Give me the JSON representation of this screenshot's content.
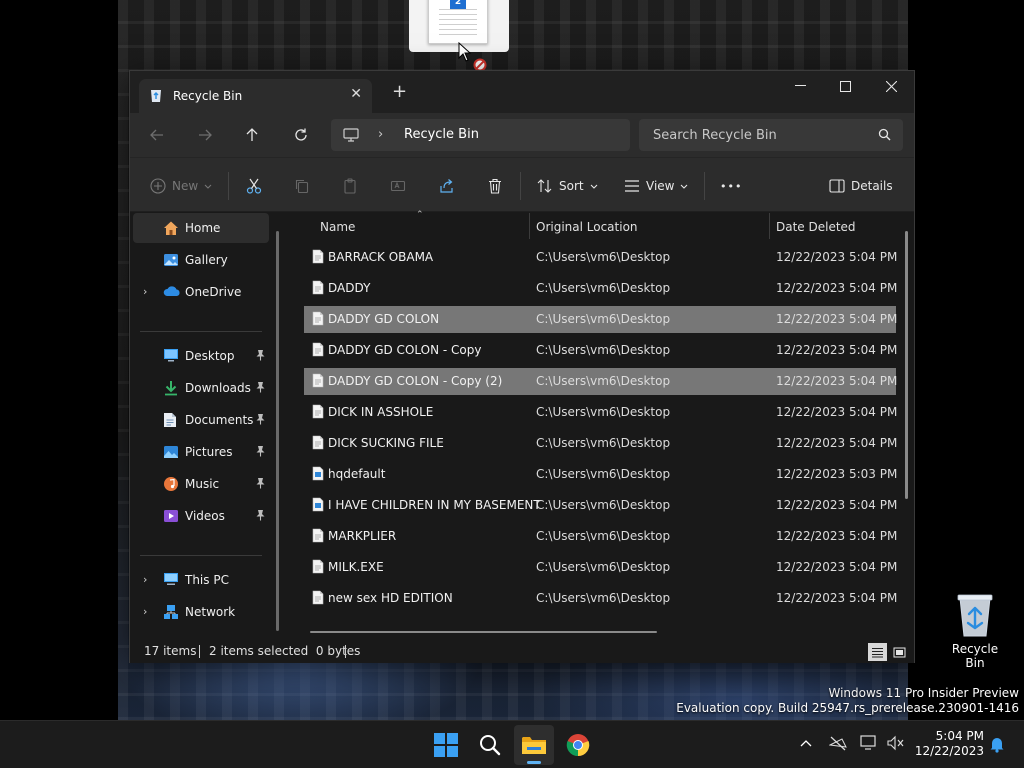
{
  "window": {
    "tab_title": "Recycle Bin",
    "tab_close": "✕",
    "new_tab": "+",
    "minimize": "—",
    "maximize": "☐",
    "close": "✕"
  },
  "nav": {
    "address_path": "Recycle Bin",
    "address_chevron": "›",
    "search_placeholder": "Search Recycle Bin"
  },
  "toolbar": {
    "new_label": "New",
    "sort_label": "Sort",
    "view_label": "View",
    "more_label": "•••",
    "details_label": "Details"
  },
  "sidebar": {
    "items": [
      {
        "label": "Home",
        "icon": "home-icon",
        "expandable": false,
        "pinned": false,
        "selected": true
      },
      {
        "label": "Gallery",
        "icon": "gallery-icon",
        "expandable": false,
        "pinned": false
      },
      {
        "label": "OneDrive",
        "icon": "onedrive-icon",
        "expandable": true,
        "pinned": false
      },
      {
        "label": "Desktop",
        "icon": "desktop-icon",
        "expandable": false,
        "pinned": true
      },
      {
        "label": "Downloads",
        "icon": "downloads-icon",
        "expandable": false,
        "pinned": true
      },
      {
        "label": "Documents",
        "icon": "documents-icon",
        "expandable": false,
        "pinned": true
      },
      {
        "label": "Pictures",
        "icon": "pictures-icon",
        "expandable": false,
        "pinned": true
      },
      {
        "label": "Music",
        "icon": "music-icon",
        "expandable": false,
        "pinned": true
      },
      {
        "label": "Videos",
        "icon": "videos-icon",
        "expandable": false,
        "pinned": true
      },
      {
        "label": "This PC",
        "icon": "this-pc-icon",
        "expandable": true,
        "pinned": false
      },
      {
        "label": "Network",
        "icon": "network-icon",
        "expandable": true,
        "pinned": false
      }
    ],
    "expand_glyph": "›"
  },
  "columns": {
    "name": "Name",
    "location": "Original Location",
    "date": "Date Deleted"
  },
  "files": [
    {
      "name": "BARRACK OBAMA",
      "location": "C:\\Users\\vm6\\Desktop",
      "date": "12/22/2023 5:04 PM",
      "selected": false
    },
    {
      "name": "DADDY",
      "location": "C:\\Users\\vm6\\Desktop",
      "date": "12/22/2023 5:04 PM",
      "selected": false
    },
    {
      "name": "DADDY GD COLON",
      "location": "C:\\Users\\vm6\\Desktop",
      "date": "12/22/2023 5:04 PM",
      "selected": true
    },
    {
      "name": "DADDY GD COLON - Copy",
      "location": "C:\\Users\\vm6\\Desktop",
      "date": "12/22/2023 5:04 PM",
      "selected": false
    },
    {
      "name": "DADDY GD COLON - Copy (2)",
      "location": "C:\\Users\\vm6\\Desktop",
      "date": "12/22/2023 5:04 PM",
      "selected": true
    },
    {
      "name": "DICK IN ASSHOLE",
      "location": "C:\\Users\\vm6\\Desktop",
      "date": "12/22/2023 5:04 PM",
      "selected": false
    },
    {
      "name": "DICK SUCKING FILE",
      "location": "C:\\Users\\vm6\\Desktop",
      "date": "12/22/2023 5:04 PM",
      "selected": false
    },
    {
      "name": "hqdefault",
      "location": "C:\\Users\\vm6\\Desktop",
      "date": "12/22/2023 5:03 PM",
      "selected": false
    },
    {
      "name": "I HAVE CHILDREN IN MY BASEMENT",
      "location": "C:\\Users\\vm6\\Desktop",
      "date": "12/22/2023 5:04 PM",
      "selected": false
    },
    {
      "name": "MARKPLIER",
      "location": "C:\\Users\\vm6\\Desktop",
      "date": "12/22/2023 5:04 PM",
      "selected": false
    },
    {
      "name": "MILK.EXE",
      "location": "C:\\Users\\vm6\\Desktop",
      "date": "12/22/2023 5:04 PM",
      "selected": false
    },
    {
      "name": "new sex HD EDITION",
      "location": "C:\\Users\\vm6\\Desktop",
      "date": "12/22/2023 5:04 PM",
      "selected": false
    }
  ],
  "status": {
    "item_count": "17 items",
    "selected_info": "2 items selected  0 bytes"
  },
  "desktop": {
    "recycle_bin_label": "Recycle Bin",
    "drag_badge": "2",
    "watermark_line1": "Windows 11 Pro Insider Preview",
    "watermark_line2": "Evaluation copy. Build 25947.rs_prerelease.230901-1416"
  },
  "taskbar": {
    "time": "5:04 PM",
    "date": "12/22/2023"
  },
  "colors": {
    "accent": "#5fb2f2",
    "selection": "#777777",
    "window_bg": "#191919",
    "chrome_bg": "#2c2c2c"
  }
}
